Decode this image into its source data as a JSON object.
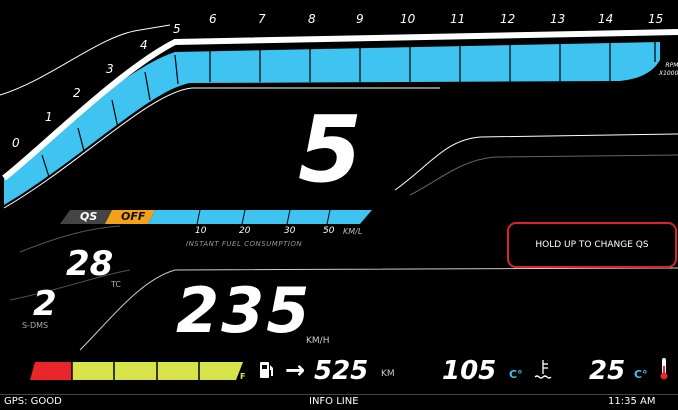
{
  "rpm_gauge": {
    "ticks": [
      "0",
      "1",
      "2",
      "3",
      "4",
      "5",
      "6",
      "7",
      "8",
      "9",
      "10",
      "11",
      "12",
      "13",
      "14",
      "15"
    ],
    "unit_line1": "RPM",
    "unit_line2": "X1000",
    "current_rpm_x1000": 14.6,
    "bar_color": "#3fc3f0"
  },
  "gear": {
    "value": "5"
  },
  "quickshifter": {
    "label": "QS",
    "state": "OFF",
    "state_color": "#f5a01a",
    "hint": "HOLD UP TO CHANGE QS"
  },
  "fuel_consumption": {
    "ticks": [
      "10",
      "20",
      "30",
      "50"
    ],
    "unit": "KM/L",
    "title": "INSTANT FUEL CONSUMPTION"
  },
  "traction_control": {
    "value": "28",
    "label": "TC"
  },
  "sdms": {
    "value": "2",
    "label": "S-DMS"
  },
  "speed": {
    "value": "235",
    "unit": "KM/H"
  },
  "fuel_level": {
    "empty_label": "E",
    "full_label": "F",
    "level_fraction": 1.0,
    "low_color": "#e8262b",
    "fill_color": "#d8e34a"
  },
  "range": {
    "value": "525",
    "unit": "KM"
  },
  "engine_temp": {
    "value": "105",
    "unit": "C°"
  },
  "air_temp": {
    "value": "25",
    "unit": "C°"
  },
  "status_bar": {
    "gps": "GPS: GOOD",
    "info": "INFO LINE",
    "time": "11:35 AM"
  }
}
